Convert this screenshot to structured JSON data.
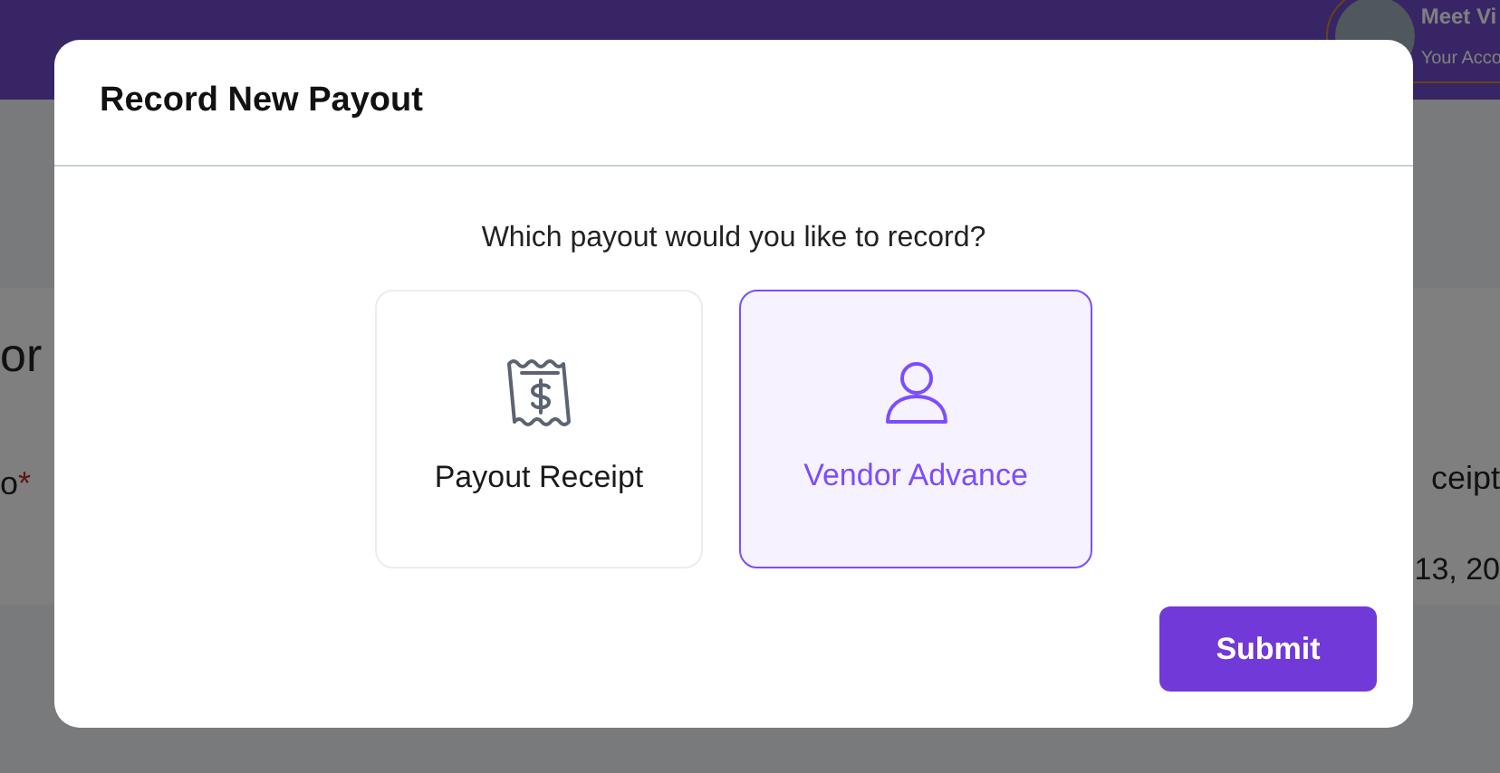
{
  "background": {
    "user": {
      "name": "Meet Vi",
      "subtitle": "Your Acco"
    },
    "left_texts": [
      "or",
      "o"
    ],
    "required_mark": "*",
    "right_texts": [
      "ceipt",
      "13, 20"
    ]
  },
  "dialog": {
    "title": "Record New Payout",
    "question": "Which payout would you like to record?",
    "options": [
      {
        "kind": "receipt",
        "label": "Payout Receipt",
        "selected": false
      },
      {
        "kind": "person",
        "label": "Vendor Advance",
        "selected": true
      }
    ],
    "submit": "Submit"
  }
}
